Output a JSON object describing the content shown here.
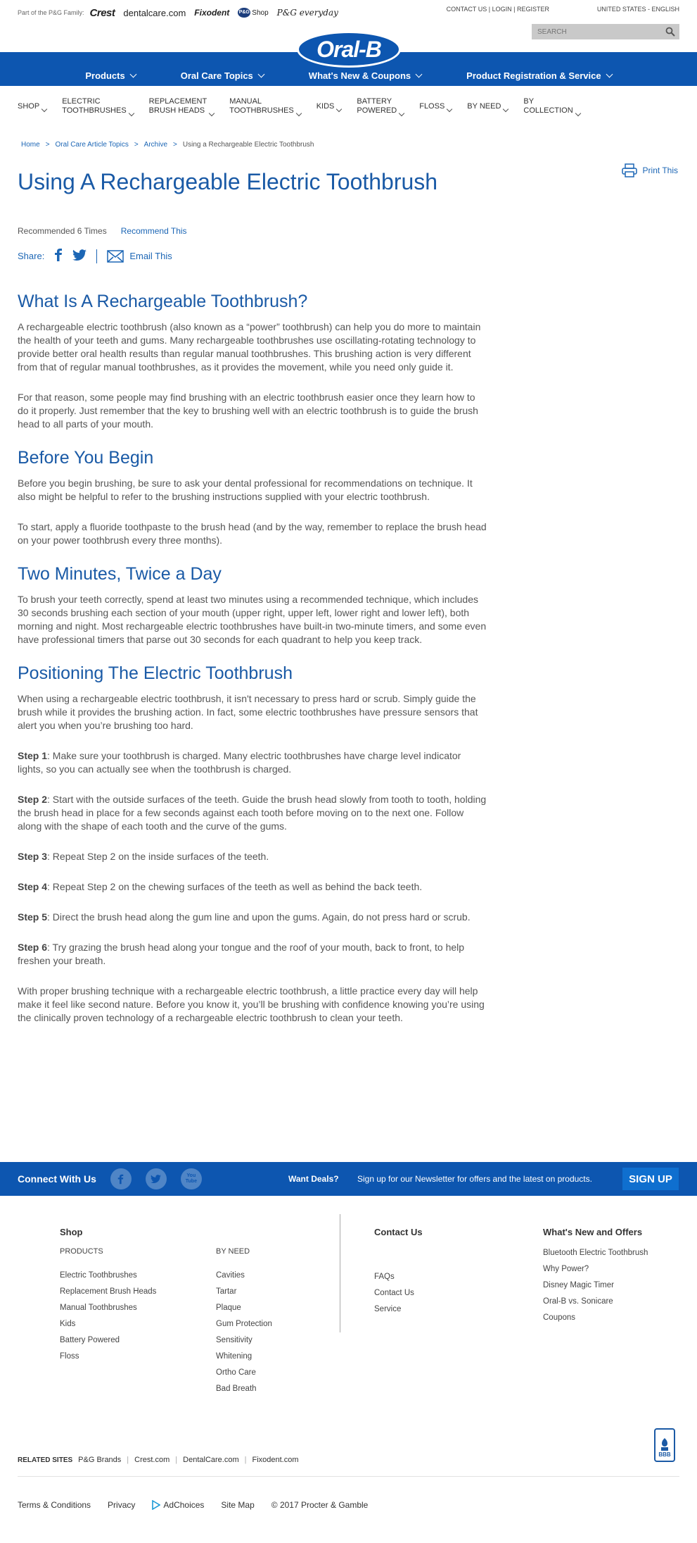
{
  "family": {
    "label": "Part of the P&G Family:",
    "brands": [
      "Crest",
      "dentalcare.com",
      "Fixodent",
      "Shop",
      "P&G everyday"
    ]
  },
  "util": {
    "contact": "CONTACT US",
    "login": "LOGIN",
    "register": "REGISTER",
    "region": "UNITED STATES - ENGLISH",
    "search_placeholder": "SEARCH"
  },
  "logo": "Oral-B",
  "main_nav": [
    "Products",
    "Oral Care Topics",
    "What's New & Coupons",
    "Product Registration & Service"
  ],
  "product_nav": [
    {
      "line1": "SHOP",
      "line2": ""
    },
    {
      "line1": "ELECTRIC",
      "line2": "TOOTHBRUSHES"
    },
    {
      "line1": "REPLACEMENT",
      "line2": "BRUSH HEADS"
    },
    {
      "line1": "MANUAL",
      "line2": "TOOTHBRUSHES"
    },
    {
      "line1": "KIDS",
      "line2": ""
    },
    {
      "line1": "BATTERY",
      "line2": "POWERED"
    },
    {
      "line1": "FLOSS",
      "line2": ""
    },
    {
      "line1": "BY NEED",
      "line2": ""
    },
    {
      "line1": "BY",
      "line2": "COLLECTION"
    }
  ],
  "breadcrumb": {
    "home": "Home",
    "topics": "Oral Care Article Topics",
    "archive": "Archive",
    "current": "Using a Rechargeable Electric Toothbrush",
    "sep": ">"
  },
  "print_label": "Print This",
  "article": {
    "title": "Using A Rechargeable Electric Toothbrush",
    "recommended": "Recommended 6 Times",
    "recommend_link": "Recommend This",
    "share_label": "Share:",
    "email_label": "Email This",
    "sections": [
      {
        "heading": "What Is A Rechargeable Toothbrush?",
        "paragraphs": [
          "A rechargeable electric toothbrush (also known as a “power” toothbrush) can help you do more to maintain the health of your teeth and gums. Many rechargeable toothbrushes use oscillating-rotating technology to provide better oral health results than regular manual toothbrushes. This brushing action is very different from that of regular manual toothbrushes, as it provides the movement, while you need only guide it.",
          "For that reason, some people may find brushing with an electric toothbrush easier once they learn how to do it properly. Just remember that the key to brushing well with an electric toothbrush is to guide the brush head to all parts of your mouth."
        ]
      },
      {
        "heading": "Before You Begin",
        "paragraphs": [
          "Before you begin brushing, be sure to ask your dental professional for recommendations on technique. It also might be helpful to refer to the brushing instructions supplied with your electric toothbrush.",
          "To start, apply a fluoride toothpaste to the brush head (and by the way, remember to replace the brush head on your power toothbrush every three months)."
        ]
      },
      {
        "heading": "Two Minutes, Twice a Day",
        "paragraphs": [
          "To brush your teeth correctly, spend at least two minutes using a recommended technique, which includes 30 seconds brushing each section of your mouth (upper right, upper left, lower right and lower left), both morning and night. Most rechargeable electric toothbrushes have built-in two-minute timers, and some even have professional timers that parse out 30 seconds for each quadrant to help you keep track."
        ]
      }
    ],
    "positioning": {
      "heading": "Positioning The Electric Toothbrush",
      "intro": "When using a rechargeable electric toothbrush, it isn't necessary to press hard or scrub. Simply guide the brush while it provides the brushing action. In fact, some electric toothbrushes have pressure sensors that alert you when you’re brushing too hard.",
      "steps": [
        {
          "label": "Step 1",
          "text": ": Make sure your toothbrush is charged. Many electric toothbrushes have charge level indicator lights, so you can actually see when the toothbrush is charged."
        },
        {
          "label": "Step 2",
          "text": ": Start with the outside surfaces of the teeth. Guide the brush head slowly from tooth to tooth, holding the brush head in place for a few seconds against each tooth before moving on to the next one. Follow along with the shape of each tooth and the curve of the gums."
        },
        {
          "label": "Step 3",
          "text": ": Repeat Step 2 on the inside surfaces of the teeth."
        },
        {
          "label": "Step 4",
          "text": ": Repeat Step 2 on the chewing surfaces of the teeth as well as behind the back teeth."
        },
        {
          "label": "Step 5",
          "text": ": Direct the brush head along the gum line and upon the gums. Again, do not press hard or scrub."
        },
        {
          "label": "Step 6",
          "text": ": Try grazing the brush head along your tongue and the roof of your mouth, back to front, to help freshen your breath."
        }
      ],
      "outro": "With proper brushing technique with a rechargeable electric toothbrush, a little practice every day will help make it feel like second nature. Before you know it, you’ll be brushing with confidence knowing you’re using the clinically proven technology of a rechargeable electric toothbrush to clean your teeth."
    }
  },
  "connect": {
    "label": "Connect With Us",
    "want_deals": "Want Deals?",
    "signup_text": "Sign up for our Newsletter for offers and the latest on products.",
    "signup_button": "SIGN UP",
    "youtube_label": "You Tube"
  },
  "footer": {
    "shop_heading": "Shop",
    "products_heading": "PRODUCTS",
    "products": [
      "Electric Toothbrushes",
      "Replacement Brush Heads",
      "Manual Toothbrushes",
      "Kids",
      "Battery Powered",
      "Floss"
    ],
    "by_need_heading": "BY NEED",
    "by_need": [
      "Cavities",
      "Tartar",
      "Plaque",
      "Gum Protection",
      "Sensitivity",
      "Whitening",
      "Ortho Care",
      "Bad Breath"
    ],
    "contact_heading": "Contact Us",
    "contact": [
      "FAQs",
      "Contact Us",
      "Service"
    ],
    "whats_new_heading": "What's New and Offers",
    "whats_new": [
      "Bluetooth Electric Toothbrush",
      "Why Power?",
      "Disney Magic Timer",
      "Oral-B vs. Sonicare",
      "Coupons"
    ]
  },
  "related": {
    "label": "RELATED SITES",
    "sites": [
      "P&G Brands",
      "Crest.com",
      "DentalCare.com",
      "Fixodent.com"
    ]
  },
  "bbb_label": "BBB",
  "legal": [
    "Terms & Conditions",
    "Privacy",
    "AdChoices",
    "Site Map",
    "© 2017 Procter & Gamble"
  ],
  "colors": {
    "brand_blue": "#0d56b0",
    "link_blue": "#1c66b5",
    "heading_blue": "#1a5aa6"
  }
}
